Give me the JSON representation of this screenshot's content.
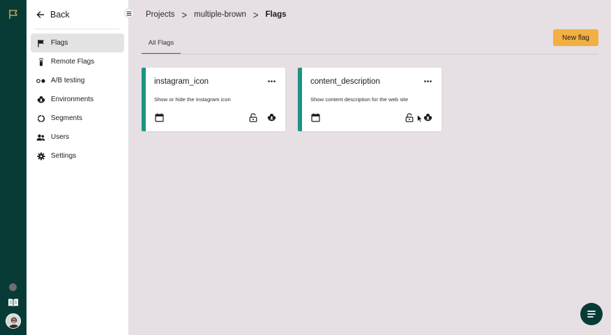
{
  "colors": {
    "rail_bg": "#083b36",
    "accent": "#1d9483",
    "primary_button": "#f2b043",
    "page_bg": "#e6dfe4"
  },
  "rail": {
    "logo_icon": "flag-outline-icon",
    "docs_icon": "book-icon",
    "avatar_icon": "user-avatar"
  },
  "sidebar": {
    "back_label": "Back",
    "items": [
      {
        "label": "Flags",
        "icon": "flag-icon",
        "active": true
      },
      {
        "label": "Remote Flags",
        "icon": "remote-icon",
        "active": false
      },
      {
        "label": "A/B testing",
        "icon": "ab-testing-icon",
        "active": false
      },
      {
        "label": "Environments",
        "icon": "environments-icon",
        "active": false
      },
      {
        "label": "Segments",
        "icon": "segments-icon",
        "active": false
      },
      {
        "label": "Users",
        "icon": "users-icon",
        "active": false
      },
      {
        "label": "Settings",
        "icon": "gear-icon",
        "active": false
      }
    ]
  },
  "breadcrumb": {
    "items": [
      "Projects",
      "multiple-brown",
      "Flags"
    ],
    "separator": ">"
  },
  "tabs": [
    {
      "label": "All Flags",
      "active": true
    }
  ],
  "new_flag_label": "New flag",
  "flags": [
    {
      "name": "instagram_icon",
      "description": "Show or hide the instagram icon"
    },
    {
      "name": "content_description",
      "description": "Show content description for the web site"
    }
  ]
}
